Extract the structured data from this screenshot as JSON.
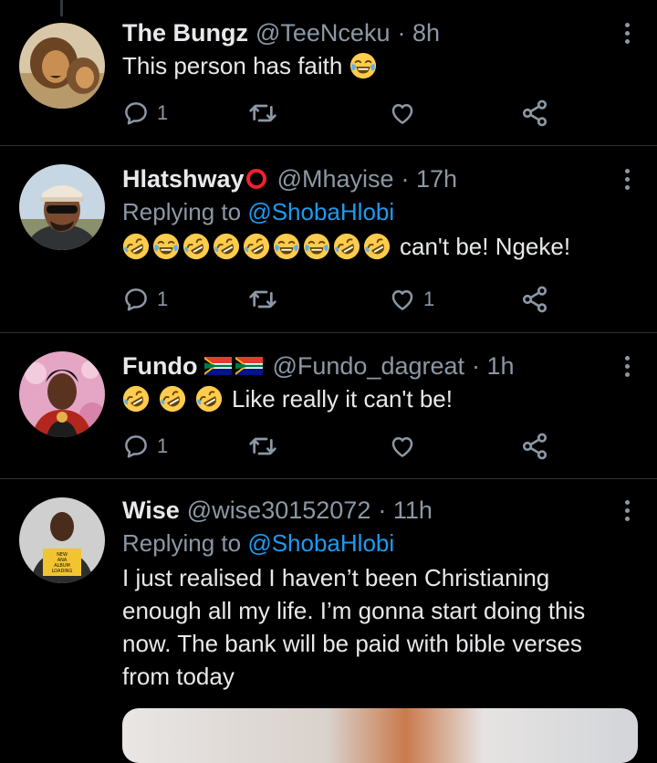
{
  "tweets": [
    {
      "name": "The Bungz",
      "handle": "@TeeNceku",
      "time": "· 8h",
      "text": "This person has faith",
      "replies": "1",
      "retweets": "",
      "likes": ""
    },
    {
      "name": "Hlatshway",
      "handle": "@Mhayise",
      "time": "· 17h",
      "replying_prefix": "Replying to",
      "replying_to": "@ShobaHlobi",
      "text": "can't be! Ngeke!",
      "replies": "1",
      "retweets": "",
      "likes": "1"
    },
    {
      "name": "Fundo",
      "handle": "@Fundo_dagreat",
      "time": "· 1h",
      "text": "Like really it can't be!",
      "replies": "1",
      "retweets": "",
      "likes": ""
    },
    {
      "name": "Wise",
      "handle": "@wise30152072",
      "time": "· 11h",
      "replying_prefix": "Replying to",
      "replying_to": "@ShobaHlobi",
      "text_lines": [
        "I just realised I haven’t been Christianing",
        "enough all my life. I’m gonna start doing this",
        "now. The bank will be paid with bible verses",
        "from today"
      ]
    }
  ],
  "avatar_sign_text": "NEW ANA ALBUM LOADING",
  "colors": {
    "background": "#000000",
    "text": "#e7e9ea",
    "secondary": "#8b98a5",
    "link": "#1d9bf0",
    "divider": "#2f3336",
    "red_circle": "#f4212e",
    "emoji_yellow": "#ffcc4d"
  },
  "icons": [
    "reply-icon",
    "retweet-icon",
    "like-icon",
    "share-icon",
    "more-icon",
    "laughing-emoji",
    "rofl-emoji",
    "south-africa-flag"
  ]
}
